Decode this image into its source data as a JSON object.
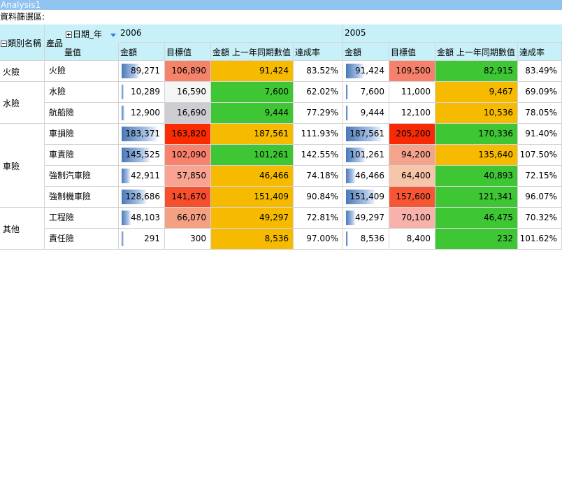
{
  "window": {
    "title": "Analysis1"
  },
  "filter": {
    "label": "資料篩選區:"
  },
  "pivot": {
    "row_fields": {
      "category": "類別名稱",
      "product": "產品"
    },
    "column_field": "日期_年",
    "measure_label": "量值",
    "years": [
      "2006",
      "2005"
    ],
    "measures": [
      "金額",
      "目標值",
      "金額 上一年同期數值",
      "達成率"
    ],
    "rows": [
      {
        "category": "火險",
        "product": "火險",
        "y2006": [
          "89,271",
          "106,890",
          "91,424",
          "83.52%"
        ],
        "y2005": [
          "91,424",
          "109,500",
          "82,915",
          "83.49%"
        ]
      },
      {
        "category": "水險",
        "product": "水險",
        "y2006": [
          "10,289",
          "16,590",
          "7,600",
          "62.02%"
        ],
        "y2005": [
          "7,600",
          "11,000",
          "9,467",
          "69.09%"
        ]
      },
      {
        "category": "",
        "product": "航船險",
        "y2006": [
          "12,900",
          "16,690",
          "9,444",
          "77.29%"
        ],
        "y2005": [
          "9,444",
          "12,100",
          "10,536",
          "78.05%"
        ]
      },
      {
        "category": "車險",
        "product": "車損險",
        "y2006": [
          "183,371",
          "163,820",
          "187,561",
          "111.93%"
        ],
        "y2005": [
          "187,561",
          "205,200",
          "170,336",
          "91.40%"
        ]
      },
      {
        "category": "",
        "product": "車責險",
        "y2006": [
          "145,525",
          "102,090",
          "101,261",
          "142.55%"
        ],
        "y2005": [
          "101,261",
          "94,200",
          "135,640",
          "107.50%"
        ]
      },
      {
        "category": "",
        "product": "強制汽車險",
        "y2006": [
          "42,911",
          "57,850",
          "46,466",
          "74.18%"
        ],
        "y2005": [
          "46,466",
          "64,400",
          "40,893",
          "72.15%"
        ]
      },
      {
        "category": "",
        "product": "強制機車險",
        "y2006": [
          "128,686",
          "141,670",
          "151,409",
          "90.84%"
        ],
        "y2005": [
          "151,409",
          "157,600",
          "121,341",
          "96.07%"
        ]
      },
      {
        "category": "其他",
        "product": "工程險",
        "y2006": [
          "48,103",
          "66,070",
          "49,297",
          "72.81%"
        ],
        "y2005": [
          "49,297",
          "70,100",
          "46,475",
          "70.32%"
        ]
      },
      {
        "category": "",
        "product": "責任險",
        "y2006": [
          "291",
          "300",
          "8,536",
          "97.00%"
        ],
        "y2005": [
          "8,536",
          "8,400",
          "232",
          "101.62%"
        ]
      }
    ],
    "bar_fraction_2006": [
      0.49,
      0.06,
      0.07,
      1.0,
      0.79,
      0.23,
      0.7,
      0.26,
      0.0
    ],
    "bar_fraction_2005": [
      0.49,
      0.04,
      0.05,
      1.0,
      0.54,
      0.25,
      0.81,
      0.26,
      0.0
    ],
    "target_colors_2006": [
      "#f5836a",
      "#f5f5f5",
      "#cdcdd2",
      "#fb2c02",
      "#f8826c",
      "#f9a393",
      "#f74e2d",
      "#f4a083",
      "#ffffff"
    ],
    "target_colors_2005": [
      "#f5806b",
      "#ffffff",
      "#ffffff",
      "#f82a05",
      "#f4a48c",
      "#f7c5a9",
      "#f65634",
      "#f7b3ab",
      "#ffffff"
    ],
    "prior_colors_2006": [
      "#f6bb00",
      "#3ec635",
      "#3ec635",
      "#f6bb00",
      "#3ec635",
      "#f6bb00",
      "#f6bb00",
      "#f6bb00",
      "#f6bb00"
    ],
    "prior_colors_2005": [
      "#3ec635",
      "#f6bb00",
      "#f6bb00",
      "#3ec635",
      "#f6bb00",
      "#3ec635",
      "#3ec635",
      "#3ec635",
      "#3ec635"
    ]
  }
}
